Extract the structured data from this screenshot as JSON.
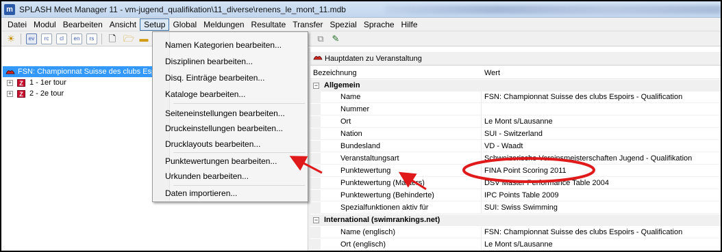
{
  "window": {
    "title": "SPLASH Meet Manager 11 - vm-jugend_qualifikation\\11_diverse\\renens_le_mont_11.mdb",
    "app_icon_letter": "m"
  },
  "menubar": {
    "items": [
      "Datei",
      "Modul",
      "Bearbeiten",
      "Ansicht",
      "Setup",
      "Global",
      "Meldungen",
      "Resultate",
      "Transfer",
      "Spezial",
      "Sprache",
      "Hilfe"
    ],
    "active": "Setup"
  },
  "toolbar": {
    "buttons": [
      "ev",
      "rc",
      "cl",
      "en",
      "rs"
    ]
  },
  "setup_menu": {
    "items": [
      "Namen Kategorien bearbeiten...",
      "Disziplinen bearbeiten...",
      "Disq. Einträge bearbeiten...",
      "Kataloge bearbeiten...",
      "Seiteneinstellungen bearbeiten...",
      "Druckeinstellungen bearbeiten...",
      "Drucklayouts bearbeiten...",
      "Punktewertungen bearbeiten...",
      "Urkunden bearbeiten...",
      "Daten importieren..."
    ]
  },
  "tree": {
    "root": "FSN: Championnat Suisse des clubs Espo",
    "children": [
      {
        "icon": "Z",
        "label": "1 - 1er tour"
      },
      {
        "icon": "Z",
        "label": "2 - 2e tour"
      }
    ]
  },
  "properties": {
    "panel_title": "Hauptdaten zu Veranstaltung",
    "col_name": "Bezeichnung",
    "col_value": "Wert",
    "section_general": "Allgemein",
    "rows_general": [
      {
        "name": "Name",
        "value": "FSN: Championnat Suisse des clubs Espoirs - Qualification"
      },
      {
        "name": "Nummer",
        "value": ""
      },
      {
        "name": "Ort",
        "value": "Le Mont s/Lausanne"
      },
      {
        "name": "Nation",
        "value": "SUI - Switzerland"
      },
      {
        "name": "Bundesland",
        "value": "VD - Waadt"
      },
      {
        "name": "Veranstaltungsart",
        "value": "Schweizerische Vereinsmeisterschaften Jugend - Qualifikation"
      },
      {
        "name": "Punktewertung",
        "value": "FINA Point Scoring 2011"
      },
      {
        "name": "Punktewertung (Masters)",
        "value": "DSV Master Performance Table 2004"
      },
      {
        "name": "Punktewertung (Behinderte)",
        "value": "IPC Points Table 2009"
      },
      {
        "name": "Spezialfunktionen aktiv für",
        "value": "SUI: Swiss Swimming"
      }
    ],
    "section_international": "International (swimrankings.net)",
    "rows_international": [
      {
        "name": "Name (englisch)",
        "value": "FSN: Championnat Suisse des clubs Espoirs - Qualification"
      },
      {
        "name": "Ort (englisch)",
        "value": "Le Mont s/Lausanne"
      }
    ]
  },
  "colors": {
    "selection": "#3399ff",
    "annotation": "#e0191b"
  }
}
